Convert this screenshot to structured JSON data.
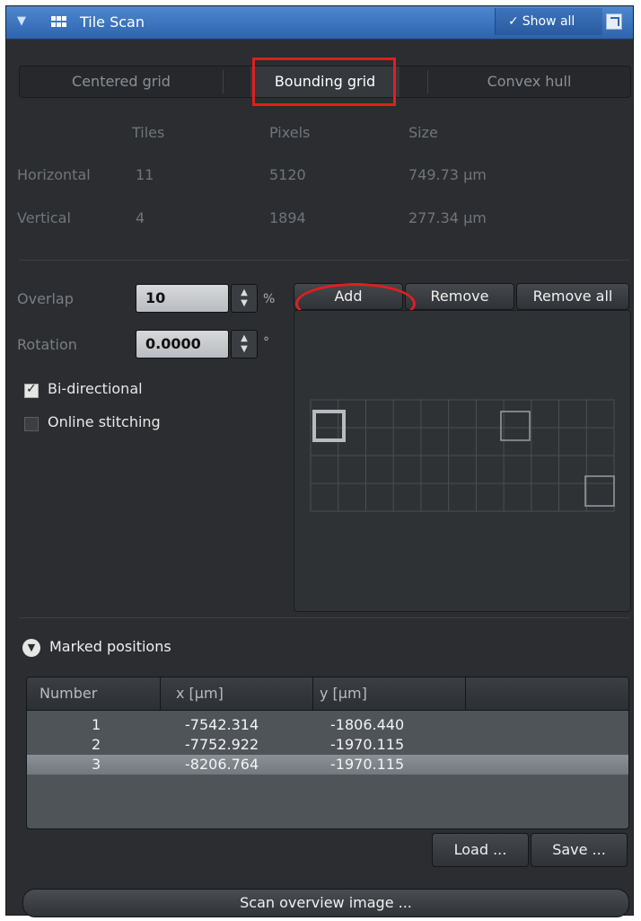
{
  "panel": {
    "title": "Tile Scan",
    "show_all": "Show all",
    "icons": {
      "collapse": "collapse-arrow-icon",
      "module": "tile-grid-icon",
      "popout": "popout-window-icon"
    }
  },
  "grid_modes": {
    "tabs": [
      "Centered grid",
      "Bounding grid",
      "Convex hull"
    ],
    "active": "Bounding grid"
  },
  "grid_info": {
    "headers": {
      "tiles": "Tiles",
      "pixels": "Pixels",
      "size": "Size"
    },
    "rows": [
      {
        "label": "Horizontal",
        "tiles": "11",
        "pixels": "5120",
        "size": "749.73 µm"
      },
      {
        "label": "Vertical",
        "tiles": "4",
        "pixels": "1894",
        "size": "277.34 µm"
      }
    ]
  },
  "settings": {
    "overlap_label": "Overlap",
    "overlap_value": "10",
    "overlap_unit": "%",
    "rotation_label": "Rotation",
    "rotation_value": "0.0000",
    "rotation_unit": "°",
    "bidirectional_label": "Bi-directional",
    "bidirectional_checked": true,
    "stitching_label": "Online stitching",
    "stitching_checked": false
  },
  "position_buttons": {
    "add": "Add",
    "remove": "Remove",
    "remove_all": "Remove all"
  },
  "preview": {
    "columns": 11,
    "rows": 4
  },
  "marked_positions": {
    "title": "Marked positions",
    "columns": [
      "Number",
      "x [µm]",
      "y [µm]"
    ],
    "rows": [
      {
        "number": "1",
        "x": "-7542.314",
        "y": "-1806.440"
      },
      {
        "number": "2",
        "x": "-7752.922",
        "y": "-1970.115"
      },
      {
        "number": "3",
        "x": "-8206.764",
        "y": "-1970.115"
      }
    ],
    "selected_row": 3,
    "load": "Load ...",
    "save": "Save ..."
  },
  "scan_overview": "Scan overview image ...",
  "colors": {
    "accent": "#2e64ad",
    "highlight": "#e01f1f",
    "panel_bg": "#2b2d30"
  }
}
